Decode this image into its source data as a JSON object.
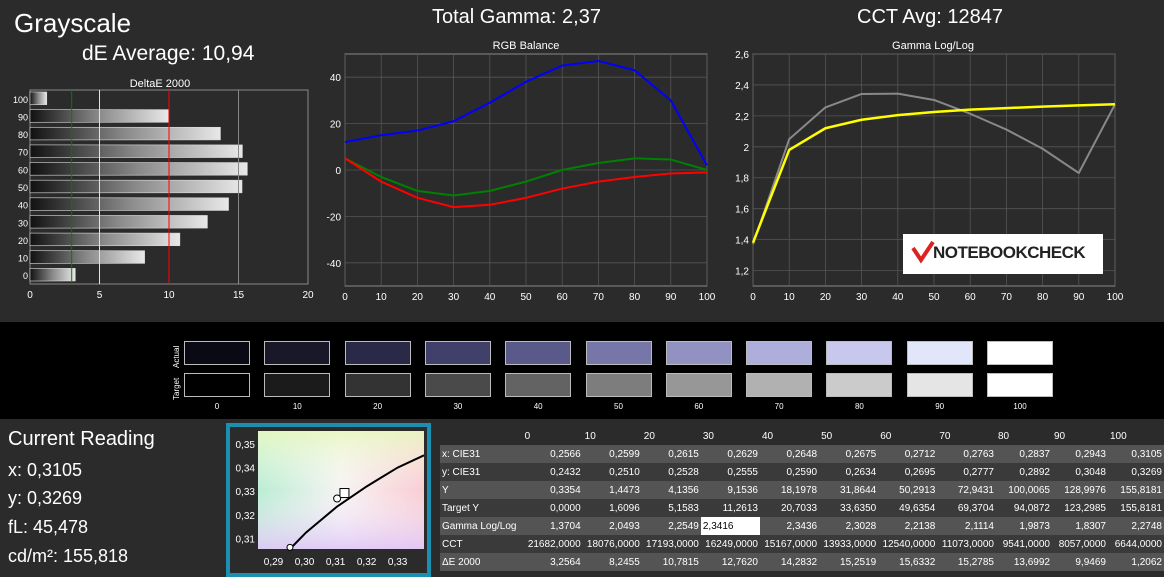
{
  "header": {
    "title": "Grayscale",
    "de_average": "dE Average: 10,94",
    "total_gamma": "Total Gamma: 2,37",
    "cct_avg": "CCT Avg: 12847"
  },
  "deltae_chart_title": "DeltaE 2000",
  "rgb_chart_title": "RGB Balance",
  "gamma_chart_title": "Gamma Log/Log",
  "logo_text": "NOTEBOOKCHECK",
  "colors": {
    "red": "#ff0000",
    "green": "#008000",
    "blue": "#0000ff",
    "yellow": "#ffff00",
    "gray": "#888888"
  },
  "chart_data": [
    {
      "type": "bar",
      "title": "DeltaE 2000",
      "categories": [
        "0",
        "10",
        "20",
        "30",
        "40",
        "50",
        "60",
        "70",
        "80",
        "90",
        "100"
      ],
      "values": [
        3.2564,
        8.2455,
        10.7815,
        12.762,
        14.2832,
        15.2519,
        15.6332,
        15.2785,
        13.6992,
        9.9469,
        1.2062
      ],
      "xlim": [
        0,
        20
      ],
      "xticks": [
        "0",
        "5",
        "10",
        "15",
        "20"
      ],
      "yticks": [
        "0",
        "10",
        "20",
        "30",
        "40",
        "50",
        "60",
        "70",
        "80",
        "90",
        "100"
      ],
      "reference_lines": [
        {
          "x": 3,
          "color": "green"
        },
        {
          "x": 5,
          "color": "yellow"
        },
        {
          "x": 10,
          "color": "red"
        },
        {
          "x": 15,
          "color": "gray"
        }
      ]
    },
    {
      "type": "line",
      "title": "RGB Balance",
      "x": [
        0,
        10,
        20,
        30,
        40,
        50,
        60,
        70,
        80,
        90,
        100
      ],
      "series": [
        {
          "color": "blue",
          "values": [
            12,
            15,
            17,
            21,
            29,
            38,
            45,
            47,
            43,
            30,
            2
          ]
        },
        {
          "color": "green",
          "values": [
            5,
            -3,
            -9,
            -11,
            -9,
            -5,
            0,
            3,
            5,
            4.5,
            0
          ]
        },
        {
          "color": "red",
          "values": [
            5,
            -5,
            -12,
            -16,
            -15,
            -12,
            -8,
            -5,
            -3,
            -1.5,
            -1
          ]
        }
      ],
      "xlim": [
        0,
        100
      ],
      "ylim": [
        -50,
        50
      ],
      "xticks": [
        "0",
        "10",
        "20",
        "30",
        "40",
        "50",
        "60",
        "70",
        "80",
        "90",
        "100"
      ],
      "yticks": [
        "40",
        "20",
        "0",
        "-20",
        "-40"
      ],
      "ytick_values": [
        40,
        20,
        0,
        -20,
        -40
      ]
    },
    {
      "type": "line",
      "title": "Gamma Log/Log",
      "x": [
        0,
        10,
        20,
        30,
        40,
        50,
        60,
        70,
        80,
        90,
        100
      ],
      "series": [
        {
          "color": "gray",
          "values": [
            1.3704,
            2.0493,
            2.2549,
            2.3416,
            2.3436,
            2.3028,
            2.2138,
            2.1114,
            1.9873,
            1.8307,
            2.2748
          ]
        },
        {
          "color": "yellow",
          "curve": "target",
          "values": [
            1.38,
            1.98,
            2.12,
            2.175,
            2.205,
            2.225,
            2.24,
            2.25,
            2.26,
            2.268,
            2.275
          ]
        }
      ],
      "xlim": [
        0,
        100
      ],
      "ylim": [
        1.1,
        2.6
      ],
      "xticks": [
        "0",
        "10",
        "20",
        "30",
        "40",
        "50",
        "60",
        "70",
        "80",
        "90",
        "100"
      ],
      "yticks": [
        "2,6",
        "2,4",
        "2,2",
        "2",
        "1,8",
        "1,6",
        "1,4",
        "1,2"
      ],
      "ytick_values": [
        2.6,
        2.4,
        2.2,
        2.0,
        1.8,
        1.6,
        1.4,
        1.2
      ]
    },
    {
      "type": "scatter",
      "title": "",
      "xticks": [
        "0,29",
        "0,30",
        "0,31",
        "0,32",
        "0,33"
      ],
      "xtick_values": [
        0.29,
        0.3,
        0.31,
        0.32,
        0.33
      ],
      "yticks": [
        "0,35",
        "0,34",
        "0,33",
        "0,32",
        "0,31"
      ],
      "ytick_values": [
        0.35,
        0.34,
        0.33,
        0.32,
        0.31
      ],
      "xlim": [
        0.285,
        0.3385
      ],
      "ylim": [
        0.3055,
        0.3555
      ],
      "locus": [
        [
          0.2953,
          0.3055
        ],
        [
          0.3005,
          0.3125
        ],
        [
          0.3105,
          0.3235
        ],
        [
          0.32,
          0.332
        ],
        [
          0.33,
          0.34
        ],
        [
          0.3385,
          0.3452
        ]
      ],
      "target_point": [
        0.3127,
        0.329
      ],
      "measured_point": [
        0.3105,
        0.3269
      ]
    }
  ],
  "swatches": {
    "actual_label": "Actual",
    "target_label": "Target",
    "labels": [
      "0",
      "10",
      "20",
      "30",
      "40",
      "50",
      "60",
      "70",
      "80",
      "90",
      "100"
    ],
    "actual_colors": [
      "#0a0a14",
      "#181828",
      "#2a2a48",
      "#40406a",
      "#5a5a8a",
      "#7676a8",
      "#9292c2",
      "#aeaedc",
      "#c8c8ee",
      "#e2e6fa",
      "#ffffff"
    ],
    "target_colors": [
      "#000000",
      "#1b1b1b",
      "#333333",
      "#4a4a4a",
      "#636363",
      "#7d7d7d",
      "#979797",
      "#b1b1b1",
      "#cbcbcb",
      "#e5e5e5",
      "#ffffff"
    ]
  },
  "current_reading": {
    "title": "Current Reading",
    "x": "x: 0,3105",
    "y": "y: 0,3269",
    "fl": "fL: 45,478",
    "cdm2": "cd/m²: 155,818"
  },
  "table": {
    "columns": [
      "",
      "0",
      "10",
      "20",
      "30",
      "40",
      "50",
      "60",
      "70",
      "80",
      "90",
      "100"
    ],
    "rows": [
      [
        "x: CIE31",
        "0,2566",
        "0,2599",
        "0,2615",
        "0,2629",
        "0,2648",
        "0,2675",
        "0,2712",
        "0,2763",
        "0,2837",
        "0,2943",
        "0,3105"
      ],
      [
        "y: CIE31",
        "0,2432",
        "0,2510",
        "0,2528",
        "0,2555",
        "0,2590",
        "0,2634",
        "0,2695",
        "0,2777",
        "0,2892",
        "0,3048",
        "0,3269"
      ],
      [
        "Y",
        "0,3354",
        "1,4473",
        "4,1356",
        "9,1536",
        "18,1978",
        "31,8644",
        "50,2913",
        "72,9431",
        "100,0065",
        "128,9976",
        "155,8181"
      ],
      [
        "Target Y",
        "0,0000",
        "1,6096",
        "5,1583",
        "11,2613",
        "20,7033",
        "33,6350",
        "49,6354",
        "69,3704",
        "94,0872",
        "123,2985",
        "155,8181"
      ],
      [
        "Gamma Log/Log",
        "1,3704",
        "2,0493",
        "2,2549",
        "2,3416",
        "2,3436",
        "2,3028",
        "2,2138",
        "2,1114",
        "1,9873",
        "1,8307",
        "2,2748"
      ],
      [
        "CCT",
        "21682,0000",
        "18076,0000",
        "17193,0000",
        "16249,0000",
        "15167,0000",
        "13933,0000",
        "12540,0000",
        "11073,0000",
        "9541,0000",
        "8057,0000",
        "6644,0000"
      ],
      [
        "ΔE 2000",
        "3,2564",
        "8,2455",
        "10,7815",
        "12,7620",
        "14,2832",
        "15,2519",
        "15,6332",
        "15,2785",
        "13,6992",
        "9,9469",
        "1,2062"
      ]
    ]
  }
}
